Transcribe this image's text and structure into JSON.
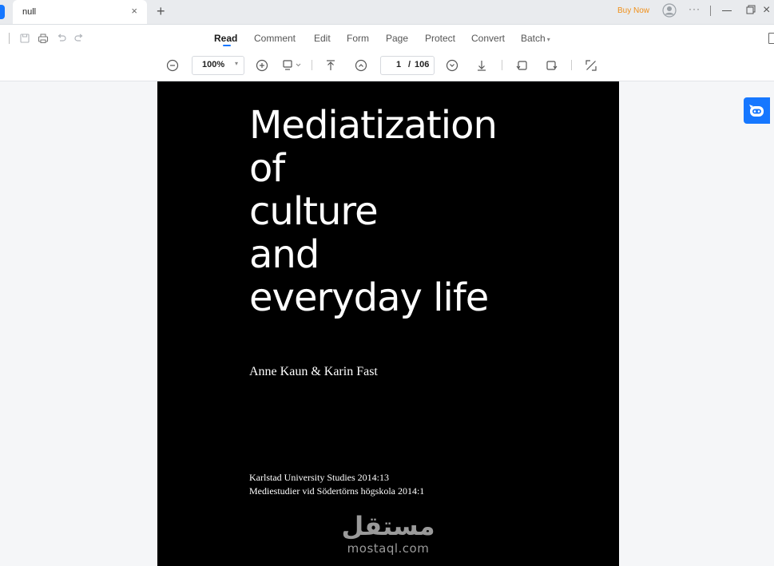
{
  "tabbar": {
    "tab_title": "null",
    "tab_close": "×",
    "new_tab": "+",
    "buy_now": "Buy Now",
    "more": "···",
    "window_close": "×"
  },
  "menu": {
    "items": [
      "Read",
      "Comment",
      "Edit",
      "Form",
      "Page",
      "Protect",
      "Convert",
      "Batch"
    ],
    "active": "Read",
    "batch_caret": "▾"
  },
  "toolbar": {
    "zoom": "100%",
    "zoom_caret": "▾",
    "page_current": "1",
    "page_separator": "/",
    "page_total": "106"
  },
  "document": {
    "title_lines": [
      "Mediatization",
      "of",
      "culture",
      "and",
      "everyday life"
    ],
    "authors": "Anne Kaun & Karin Fast",
    "series_lines": [
      "Karlstad University Studies 2014:13",
      "Mediestudier vid Södertörns högskola 2014:1"
    ]
  },
  "watermark": {
    "arabic": "مستقل",
    "latin": "mostaql.com"
  },
  "colors": {
    "accent": "#1677ff",
    "buy_now": "#f0901a",
    "page_background": "#000000"
  },
  "icons": {
    "quick_access": [
      "save-icon",
      "print-icon",
      "undo-icon",
      "redo-icon"
    ],
    "toolbar": [
      "zoom-out-icon",
      "zoom-in-icon",
      "view-mode-icon",
      "first-page-icon",
      "previous-page-icon",
      "next-page-icon",
      "last-page-icon",
      "rotate-left-icon",
      "rotate-right-icon",
      "fullscreen-icon"
    ],
    "assistant": "ai-assistant-icon"
  }
}
